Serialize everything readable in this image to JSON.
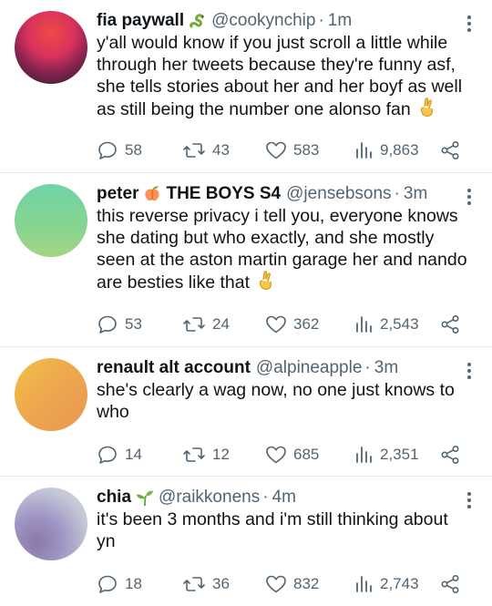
{
  "tweets": [
    {
      "name": "fia paywall",
      "emoji_icon": "snake-emoji-icon",
      "handle": "@cookynchip",
      "separator": "·",
      "time": "1m",
      "text": "y'all would know if you just scroll a little while through her tweets because they're funny asf, she tells stories about her and her boyf as well as still being the number one alonso fan",
      "trailing_icon": "crossed-fingers-emoji-icon",
      "replies": "58",
      "retweets": "43",
      "likes": "583",
      "views": "9,863",
      "avatar_colors": [
        "#e8304e",
        "#c92a5a",
        "#2d1a2a"
      ]
    },
    {
      "name": "peter",
      "emoji_icon": "peach-emoji-icon",
      "name_suffix": "THE BOYS S4",
      "handle": "@jensebsons",
      "separator": "·",
      "time": "3m",
      "text": "this reverse privacy i tell you, everyone knows she dating but who exactly, and she mostly seen at the aston martin garage her and nando are besties like that",
      "trailing_icon": "crossed-fingers-emoji-icon",
      "replies": "53",
      "retweets": "24",
      "likes": "362",
      "views": "2,543",
      "avatar_colors": [
        "#6fd3a4",
        "#8fd48e",
        "#a8d684"
      ]
    },
    {
      "name": "renault alt account",
      "handle": "@alpineapple",
      "separator": "·",
      "time": "3m",
      "text": "she's clearly a wag now, no one just knows to who",
      "replies": "14",
      "retweets": "12",
      "likes": "685",
      "views": "2,351",
      "avatar_colors": [
        "#f0b84a",
        "#eea74e",
        "#e89a52"
      ]
    },
    {
      "name": "chia",
      "emoji_icon": "seedling-emoji-icon",
      "handle": "@raikkonens",
      "separator": "·",
      "time": "4m",
      "text": "it's been 3 months and i'm still thinking about yn",
      "replies": "18",
      "retweets": "36",
      "likes": "832",
      "views": "2,743",
      "avatar_colors": [
        "#c9cfd9",
        "#9d97c7",
        "#8a7aa6"
      ]
    }
  ],
  "colors": {
    "text": "#0f1419",
    "secondary": "#536471",
    "divider": "#e6e9eb"
  }
}
